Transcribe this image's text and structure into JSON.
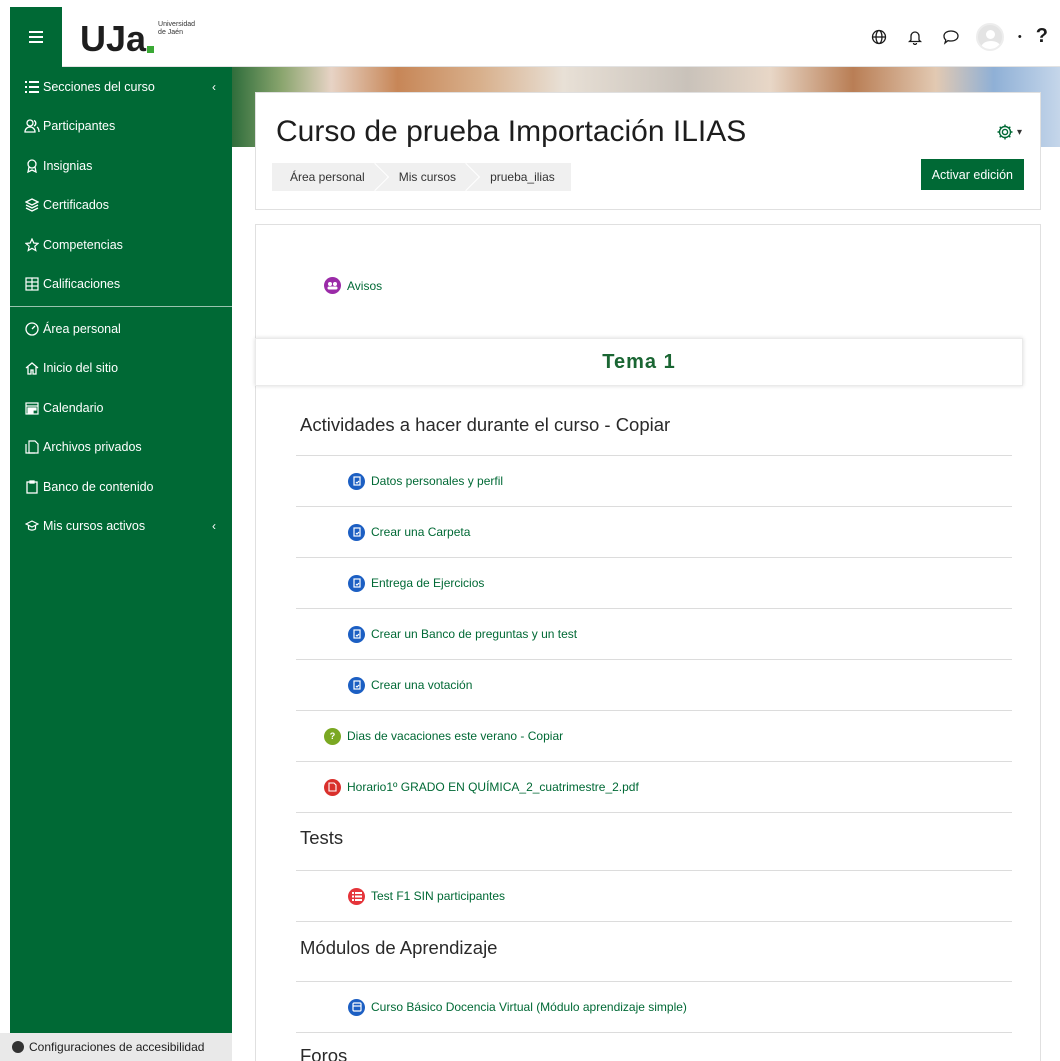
{
  "navbar": {
    "menu_icon": "hamburger-icon",
    "logo_text": "UJa",
    "logo_sub": "Universidad de Jaén",
    "icons": [
      "globe-icon",
      "bell-icon",
      "chat-icon",
      "avatar",
      "help-icon"
    ],
    "help_label": "?"
  },
  "sidebar": {
    "items": [
      {
        "label": "Secciones del curso",
        "icon": "list-icon"
      },
      {
        "label": "Participantes",
        "icon": "users-icon"
      },
      {
        "label": "Insignias",
        "icon": "badge-icon"
      },
      {
        "label": "Certificados",
        "icon": "certificate-icon"
      },
      {
        "label": "Competencias",
        "icon": "star-icon"
      },
      {
        "label": "Calificaciones",
        "icon": "grades-icon"
      }
    ],
    "items2": [
      {
        "label": "Área personal",
        "icon": "dashboard-icon"
      },
      {
        "label": "Inicio del sitio",
        "icon": "home-icon"
      },
      {
        "label": "Calendario",
        "icon": "calendar-icon"
      },
      {
        "label": "Archivos privados",
        "icon": "files-icon"
      },
      {
        "label": "Banco de contenido",
        "icon": "clipboard-icon"
      },
      {
        "label": "Mis cursos activos",
        "icon": "graduation-icon"
      }
    ],
    "accessibility": "Configuraciones de accesibilidad"
  },
  "header": {
    "title": "Curso de prueba Importación ILIAS",
    "breadcrumb": [
      "Área personal",
      "Mis cursos",
      "prueba_ilias"
    ],
    "edit_button": "Activar edición"
  },
  "content": {
    "avisos": "Avisos",
    "tema": "Tema 1",
    "section1": "Actividades a hacer durante el curso - Copiar",
    "activities": [
      "Datos personales y perfil",
      "Crear una Carpeta",
      "Entrega de Ejercicios",
      "Crear un Banco de preguntas y un test",
      "Crear una votación"
    ],
    "question": "Dias de vacaciones este verano - Copiar",
    "pdf": "Horario1º GRADO EN QUÍMICA_2_cuatrimestre_2.pdf",
    "section2": "Tests",
    "test": "Test F1 SIN participantes",
    "section3": "Módulos de Aprendizaje",
    "lesson": "Curso Básico Docencia Virtual (Módulo aprendizaje simple)",
    "section4": "Foros"
  },
  "colors": {
    "brand_green": "#006935",
    "forum": "#9b2ba8",
    "assign": "#1c5fc3",
    "pdf": "#d9302c"
  }
}
